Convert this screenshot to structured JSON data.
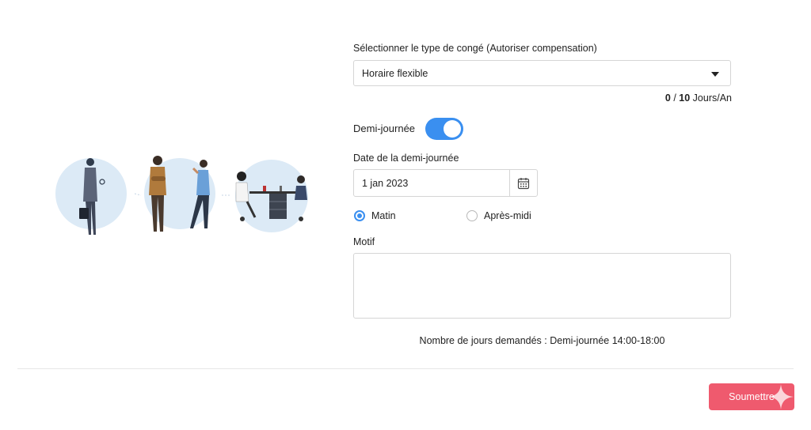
{
  "form": {
    "leave_type_label": "Sélectionner le type de congé (Autoriser compensation)",
    "leave_type_value": "Horaire flexible",
    "quota_used": "0",
    "quota_separator": " / ",
    "quota_total": "10",
    "quota_unit": " Jours/An",
    "half_day_label": "Demi-journée",
    "half_day_enabled": true,
    "date_label": "Date de la demi-journée",
    "date_value": "1 jan 2023",
    "radio_morning": "Matin",
    "radio_afternoon": "Après-midi",
    "selected_period": "Matin",
    "reason_label": "Motif",
    "reason_value": "",
    "summary": "Nombre de jours demandés : Demi-journée 14:00-18:00",
    "submit_label": "Soumettre"
  },
  "colors": {
    "accent": "#3a8ff0",
    "submit": "#ef5a6e",
    "illustration_bg": "#dceaf6"
  },
  "icons": {
    "calendar": "calendar-icon",
    "dropdown": "caret-down-icon",
    "sparkle": "sparkle-icon"
  }
}
